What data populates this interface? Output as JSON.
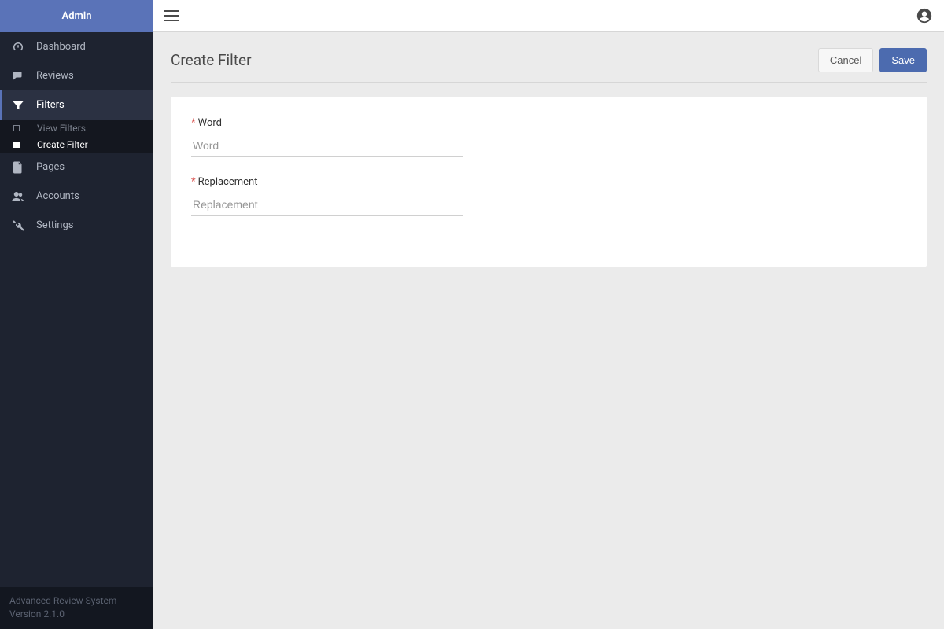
{
  "sidebar": {
    "brand": "Admin",
    "items": [
      {
        "label": "Dashboard"
      },
      {
        "label": "Reviews"
      },
      {
        "label": "Filters"
      },
      {
        "label": "Pages"
      },
      {
        "label": "Accounts"
      },
      {
        "label": "Settings"
      }
    ],
    "sub": [
      {
        "label": "View Filters"
      },
      {
        "label": "Create Filter"
      }
    ],
    "footer": {
      "line1": "Advanced Review System",
      "line2": "Version 2.1.0"
    }
  },
  "page": {
    "title": "Create Filter",
    "cancel": "Cancel",
    "save": "Save"
  },
  "form": {
    "word_label": "Word",
    "word_placeholder": "Word",
    "replacement_label": "Replacement",
    "replacement_placeholder": "Replacement"
  }
}
